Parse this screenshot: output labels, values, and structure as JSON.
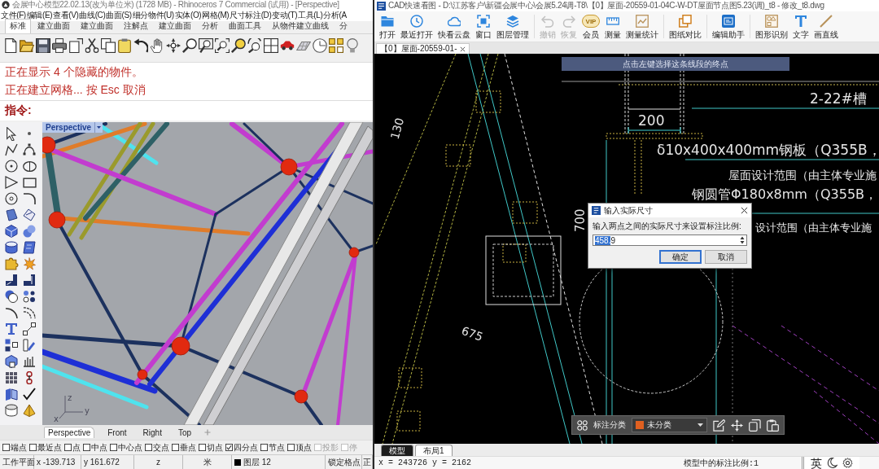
{
  "rhino": {
    "title": "会展中心模型22.02.13(改为单位米) (1728 MB) - Rhinoceros 7 Commercial (试用) - [Perspective]",
    "menu": [
      "文件(F)",
      "编辑(E)",
      "查看(V)",
      "曲线(C)",
      "曲面(S)",
      "细分物件(U)",
      "实体(O)",
      "网格(M)",
      "尺寸标注(D)",
      "变动(T)",
      "工具(L)",
      "分析(A"
    ],
    "toolbar_tabs": [
      {
        "label": "标准",
        "selected": true
      },
      {
        "label": "建立曲面",
        "selected": false
      },
      {
        "label": "建立曲面",
        "selected": false
      },
      {
        "label": "注解点",
        "selected": false
      },
      {
        "label": "建立曲面",
        "selected": false
      },
      {
        "label": "分析",
        "selected": false
      },
      {
        "label": "曲面工具",
        "selected": false
      },
      {
        "label": "从物件建立曲线",
        "selected": false
      },
      {
        "label": "分",
        "selected": false
      }
    ],
    "command_history": [
      "正在显示 4 个隐藏的物件。",
      "正在建立网格... 按 Esc 取消"
    ],
    "command_prompt": "指令:",
    "viewport": {
      "title": "Perspective",
      "axes": [
        "z",
        "y",
        "x"
      ]
    },
    "viewport_tabs": [
      {
        "label": "Perspective",
        "selected": true
      },
      {
        "label": "Front",
        "selected": false
      },
      {
        "label": "Right",
        "selected": false
      },
      {
        "label": "Top",
        "selected": false
      }
    ],
    "osnaps": [
      {
        "label": "端点",
        "checked": false,
        "disabled": false
      },
      {
        "label": "最近点",
        "checked": false,
        "disabled": false
      },
      {
        "label": "点",
        "checked": false,
        "disabled": false
      },
      {
        "label": "中点",
        "checked": false,
        "disabled": false
      },
      {
        "label": "中心点",
        "checked": false,
        "disabled": false
      },
      {
        "label": "交点",
        "checked": false,
        "disabled": false
      },
      {
        "label": "垂点",
        "checked": false,
        "disabled": false
      },
      {
        "label": "切点",
        "checked": false,
        "disabled": false
      },
      {
        "label": "四分点",
        "checked": true,
        "disabled": false
      },
      {
        "label": "节点",
        "checked": false,
        "disabled": false
      },
      {
        "label": "顶点",
        "checked": false,
        "disabled": false
      },
      {
        "label": "投影",
        "checked": false,
        "disabled": true
      },
      {
        "label": "停",
        "checked": false,
        "disabled": true
      }
    ],
    "status_bar": [
      "工作平面",
      "x -139.713",
      "y 161.672",
      "z",
      "米",
      "图层 12",
      "锁定格点",
      "正"
    ]
  },
  "cad": {
    "title": "CAD快速看图 - D:\\江苏客户\\新疆会展中心\\会展5.24调-T8\\【0】屋面-20559-01-04C-W-DT屋面节点图5.23(调)_t8 - 修改_t8.dwg",
    "toolbar": [
      {
        "label": "打开",
        "disabled": false
      },
      {
        "label": "最近打开",
        "disabled": false
      },
      {
        "label": "快看云盘",
        "disabled": false
      },
      {
        "label": "窗口",
        "disabled": false
      },
      {
        "label": "图层管理",
        "disabled": false
      },
      {
        "label": "撤销",
        "disabled": true
      },
      {
        "label": "恢复",
        "disabled": true
      },
      {
        "label": "会员",
        "disabled": false,
        "badge": "VIP"
      },
      {
        "label": "测量",
        "disabled": false
      },
      {
        "label": "测量统计",
        "disabled": false
      },
      {
        "label": "图纸对比",
        "disabled": false
      },
      {
        "label": "编辑助手",
        "disabled": false
      },
      {
        "label": "图形识别",
        "disabled": false
      },
      {
        "label": "文字",
        "disabled": false
      },
      {
        "label": "画直线",
        "disabled": false
      }
    ],
    "document_tab": "【0】屋面-20559-01-",
    "prompt": "点击左键选择这条线段的终点",
    "drawing_labels": [
      "2-22#槽",
      "200",
      "130",
      "δ10x400x400mm钢板（Q355B，",
      "屋面设计范围（由主体专业施",
      "钢圆管Φ180x8mm（Q355B，",
      "700",
      "设计范围（由主体专业施",
      "675"
    ],
    "dialog": {
      "title": "输入实际尺寸",
      "prompt": "输入两点之间的实际尺寸来设置标注比例:",
      "value_parts": [
        {
          "text": "458.",
          "selected": true
        },
        {
          "text": "9",
          "selected": false
        }
      ],
      "buttons": [
        {
          "label": "确定",
          "default": true
        },
        {
          "label": "取消",
          "default": false
        }
      ]
    },
    "annotation_toolbar": {
      "label": "标注分类",
      "category": {
        "value": "未分类",
        "color": "#e06020"
      }
    },
    "layout_tabs": [
      {
        "label": "模型",
        "selected": true
      },
      {
        "label": "布局1",
        "selected": false
      }
    ],
    "status_bar": {
      "coordinates": "x = 243726 y = 2162",
      "annotation_scale": "模型中的标注比例:1",
      "input_method": "英"
    }
  }
}
